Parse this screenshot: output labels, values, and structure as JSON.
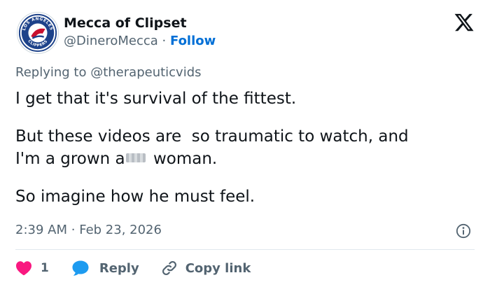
{
  "author": {
    "display_name": "Mecca of Clipset",
    "handle": "@DineroMecca",
    "separator": "·",
    "follow_label": "Follow",
    "avatar": {
      "ring_text_top": "LOS ANGELES",
      "ring_text_bottom": "CLIPPERS",
      "icon": "clippers-logo"
    }
  },
  "platform_icon": "x-logo-icon",
  "reply_context": {
    "prefix": "Replying to",
    "mention": "@therapeuticvids"
  },
  "tweet": {
    "line1": "I get that it's survival of the fittest.",
    "line2": "But these videos are  so traumatic to watch, and",
    "line3_before": "I'm a grown a",
    "line3_after": " woman.",
    "line4": "So imagine how he must feel."
  },
  "timestamp": {
    "time": "2:39 AM",
    "separator": "·",
    "date": "Feb 23, 2026"
  },
  "actions": {
    "like_count": "1",
    "reply_label": "Reply",
    "copy_label": "Copy link"
  },
  "colors": {
    "text": "#0f1419",
    "secondary": "#536471",
    "link": "#006fd6",
    "like": "#f91880",
    "reply": "#1d9bf0",
    "divider": "#e1e8ed"
  }
}
